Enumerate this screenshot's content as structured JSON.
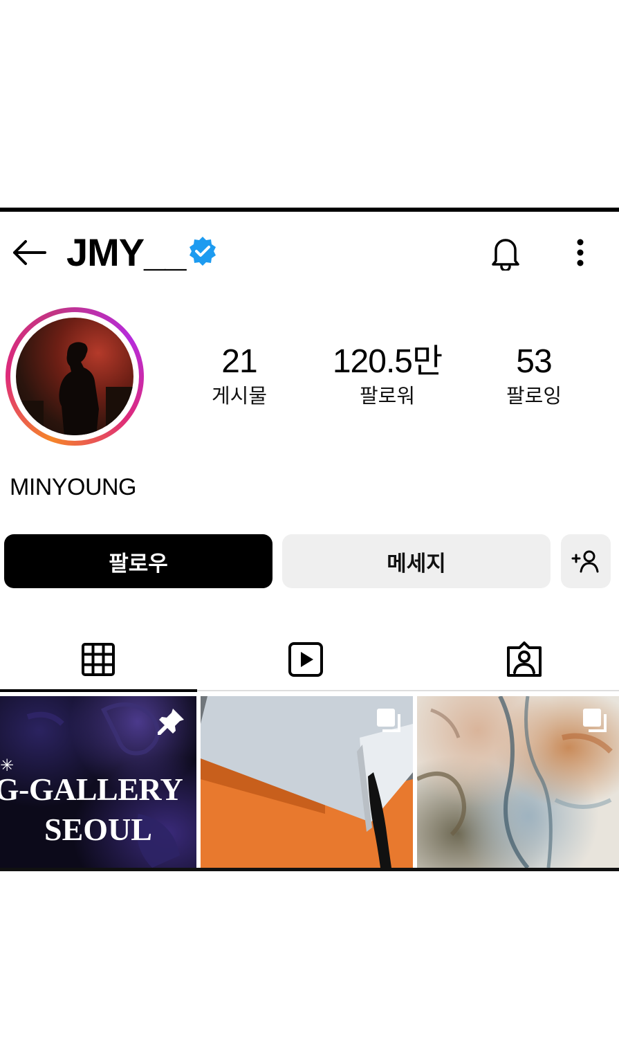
{
  "header": {
    "username": "JMY__",
    "icons": {
      "back": "arrow-left-icon",
      "verified": "verified-badge-icon",
      "notifications": "bell-icon",
      "more": "more-vertical-icon"
    }
  },
  "profile": {
    "display_name": "MINYOUNG",
    "stats": [
      {
        "value": "21",
        "label": "게시물"
      },
      {
        "value": "120.5만",
        "label": "팔로워"
      },
      {
        "value": "53",
        "label": "팔로잉"
      }
    ]
  },
  "actions": {
    "follow_label": "팔로우",
    "message_label": "메세지",
    "suggest_icon": "add-person-icon"
  },
  "tabs": [
    {
      "icon": "grid-icon",
      "selected": true
    },
    {
      "icon": "reels-play-icon",
      "selected": false
    },
    {
      "icon": "tagged-person-icon",
      "selected": false
    }
  ],
  "posts": [
    {
      "line1": "G-GALLERY",
      "line2": "SEOUL",
      "badge": "pin-icon"
    },
    {
      "badge": "multiple-images-icon"
    },
    {
      "badge": "multiple-images-icon"
    }
  ],
  "colors": {
    "verified_blue": "#1d9bf0",
    "follow_button": "#000000",
    "secondary_button": "#efefef"
  }
}
